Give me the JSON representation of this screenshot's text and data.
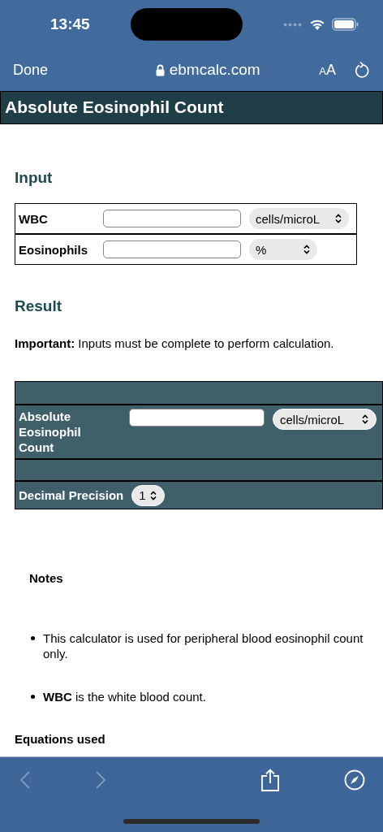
{
  "status_bar": {
    "time": "13:45"
  },
  "browser": {
    "done": "Done",
    "url": "ebmcalc.com",
    "text_size": "AA"
  },
  "page": {
    "title": "Absolute Eosinophil Count",
    "input": {
      "heading": "Input",
      "rows": [
        {
          "label": "WBC",
          "unit": "cells/microL"
        },
        {
          "label": "Eosinophils",
          "unit": "%"
        }
      ]
    },
    "result": {
      "heading": "Result",
      "note": "**Important:** Inputs must be complete to perform calculation.",
      "rows": [
        {
          "kind": "blank"
        },
        {
          "kind": "output",
          "label": "Absolute Eosinophil Count",
          "unit": "cells/microL"
        },
        {
          "kind": "blank"
        },
        {
          "kind": "precision",
          "label": "Decimal Precision",
          "value": "1"
        }
      ]
    },
    "notes": {
      "heading": "Notes",
      "items": [
        "This calculator is used for peripheral blood eosinophil count only.",
        "**WBC** is the white blood count."
      ]
    },
    "next_heading": "Equations used"
  },
  "toolbar": {
    "back": {
      "disabled": true
    },
    "forward": {
      "disabled": true
    }
  }
}
